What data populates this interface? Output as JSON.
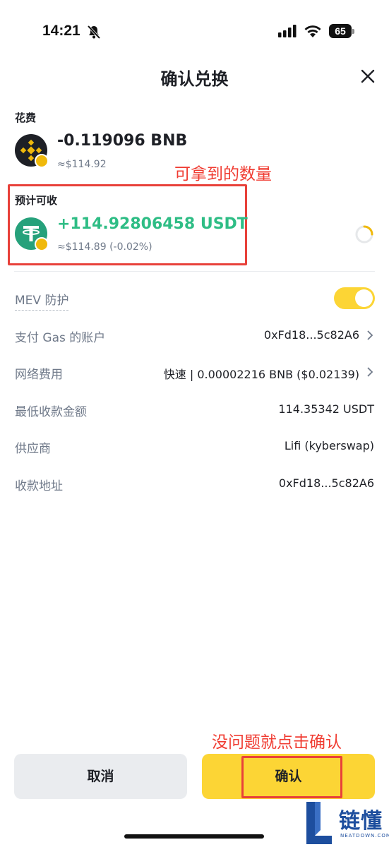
{
  "status_bar": {
    "time": "14:21",
    "battery": "65"
  },
  "header": {
    "title": "确认兑换"
  },
  "spend": {
    "label": "花费",
    "amount": "-0.119096 BNB",
    "usd": "≈$114.92",
    "coin_icon": "bnb-icon"
  },
  "receive": {
    "label": "预计可收",
    "amount": "+114.92806458 USDT",
    "usd": "≈$114.89 (-0.02%)",
    "coin_icon": "usdt-icon"
  },
  "annotations": {
    "receive_note": "可拿到的数量",
    "confirm_note": "没问题就点击确认"
  },
  "details": {
    "mev_label": "MEV 防护",
    "mev_enabled": true,
    "gas_account_label": "支付 Gas 的账户",
    "gas_account_value": "0xFd18...5c82A6",
    "network_fee_label": "网络费用",
    "network_fee_value": "快速 | 0.00002216 BNB ($0.02139)",
    "min_receive_label": "最低收款金额",
    "min_receive_value": "114.35342 USDT",
    "provider_label": "供应商",
    "provider_value": "Lifi (kyberswap)",
    "receive_address_label": "收款地址",
    "receive_address_value": "0xFd18...5c82A6"
  },
  "buttons": {
    "cancel": "取消",
    "confirm": "确认"
  },
  "watermark": {
    "brand": "链懂",
    "site": "NEATDOWN.COM"
  },
  "colors": {
    "accent": "#fcd535",
    "positive": "#2ebd85",
    "annotation": "#f03c32",
    "muted": "#707a8a"
  }
}
